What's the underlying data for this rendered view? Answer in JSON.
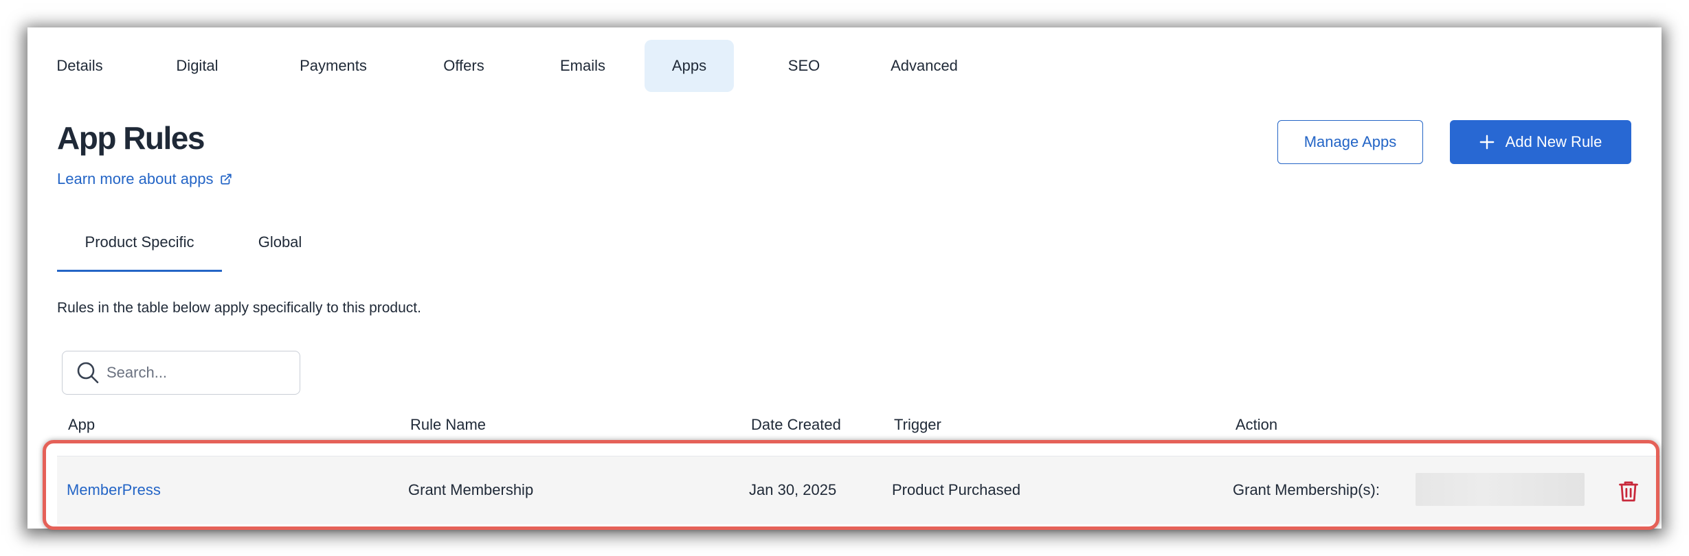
{
  "nav": {
    "tabs": [
      {
        "label": "Details"
      },
      {
        "label": "Digital"
      },
      {
        "label": "Payments"
      },
      {
        "label": "Offers"
      },
      {
        "label": "Emails"
      },
      {
        "label": "Apps",
        "active": true
      },
      {
        "label": "SEO"
      },
      {
        "label": "Advanced"
      }
    ]
  },
  "header": {
    "title": "App Rules",
    "learn_more": "Learn more about apps",
    "manage_apps": "Manage Apps",
    "add_rule": "Add New Rule"
  },
  "subtabs": [
    {
      "label": "Product Specific",
      "active": true
    },
    {
      "label": "Global"
    }
  ],
  "description": "Rules in the table below apply specifically to this product.",
  "search": {
    "placeholder": "Search...",
    "value": ""
  },
  "table": {
    "headers": [
      "App",
      "Rule Name",
      "Date Created",
      "Trigger",
      "Action"
    ],
    "rows": [
      {
        "app": "MemberPress",
        "rule_name": "Grant Membership",
        "date_created": "Jan 30, 2025",
        "trigger": "Product Purchased",
        "action": "Grant Membership(s):"
      }
    ]
  },
  "icons": {
    "external": "external-link-icon",
    "plus": "plus-icon",
    "search": "search-icon",
    "trash": "trash-icon"
  },
  "colors": {
    "accent": "#2465c6",
    "primary_button": "#2868d3",
    "active_tab_bg": "#e4f0fb",
    "danger": "#c8283a",
    "highlight": "#e56158"
  }
}
